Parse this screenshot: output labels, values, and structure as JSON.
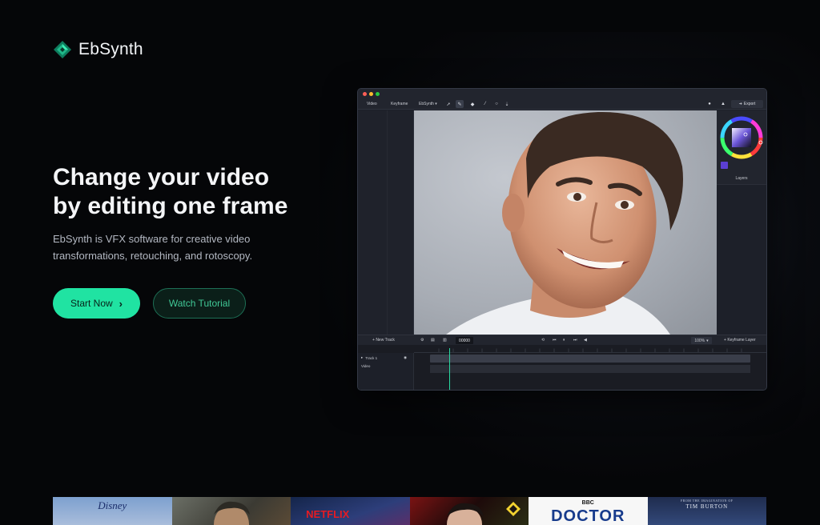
{
  "brand": {
    "name": "EbSynth",
    "accent": "#20e3a2"
  },
  "hero": {
    "title_line1": "Change your video",
    "title_line2": "by editing one frame",
    "subtitle_line1": "EbSynth is VFX software for creative video",
    "subtitle_line2": "transformations, retouching, and rotoscopy.",
    "primary_cta": "Start Now",
    "secondary_cta": "Watch Tutorial"
  },
  "app": {
    "toolbar": {
      "tab_video": "Video",
      "tab_keyframe": "Keyframe",
      "menu": "EbSynth",
      "export": "Export"
    },
    "right_panel": {
      "layers": "Layers"
    },
    "bottom": {
      "new_track": "New Track",
      "frame": "00000",
      "zoom": "100%",
      "keyframe_layer": "Keyframe Layer"
    },
    "tracks": {
      "track1": "Track 1",
      "video": "Video"
    }
  },
  "showcase": [
    {
      "label": "Disney"
    },
    {
      "label": ""
    },
    {
      "label": "NETFLIX"
    },
    {
      "label": ""
    },
    {
      "label": "BBC",
      "label2": "DOCTOR"
    },
    {
      "label": "FROM THE IMAGINATION OF",
      "label2": "TIM BURTON"
    }
  ]
}
